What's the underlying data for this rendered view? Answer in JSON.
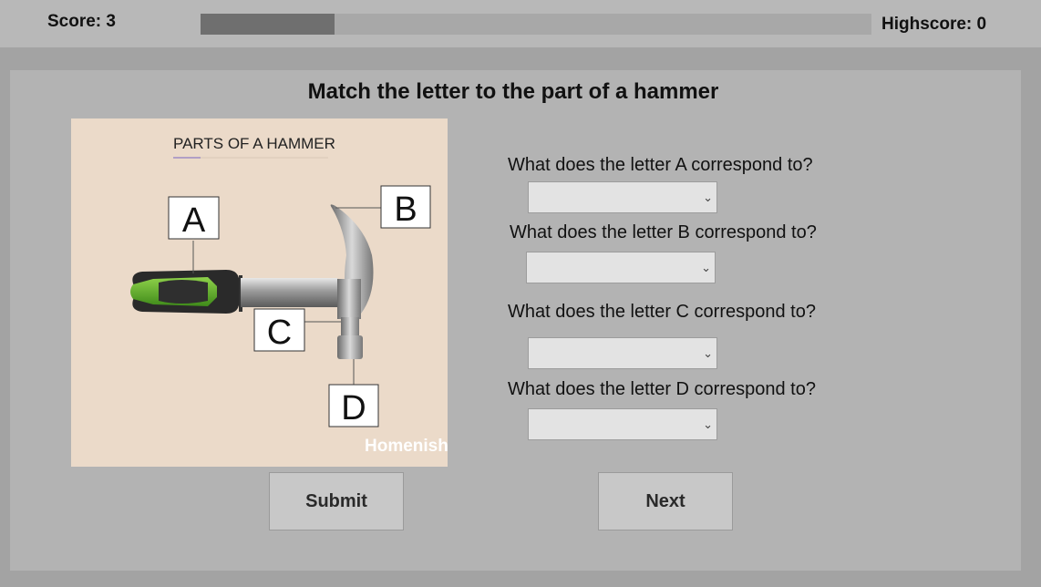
{
  "header": {
    "score": "Score: 3",
    "highscore": "Highscore: 0",
    "progress_fraction": 0.2
  },
  "main": {
    "title": "Match the letter to the part of a hammer",
    "image": {
      "heading": "PARTS OF A HAMMER",
      "labels": [
        "A",
        "B",
        "C",
        "D"
      ],
      "watermark": "Homenish"
    },
    "questions": [
      {
        "text": "What does the letter A correspond to?",
        "selected": ""
      },
      {
        "text": "What does the letter B correspond to?",
        "selected": ""
      },
      {
        "text": "What does the letter C correspond to?",
        "selected": ""
      },
      {
        "text": "What does the letter D correspond to?",
        "selected": ""
      }
    ],
    "submit_label": "Submit",
    "next_label": "Next"
  },
  "colors": {
    "background": "#a3a3a3",
    "topbar": "#b8b8b8",
    "panel": "#b3b3b3",
    "progress_fill": "#6f6f6f",
    "grip_green": "#5fb82a"
  }
}
